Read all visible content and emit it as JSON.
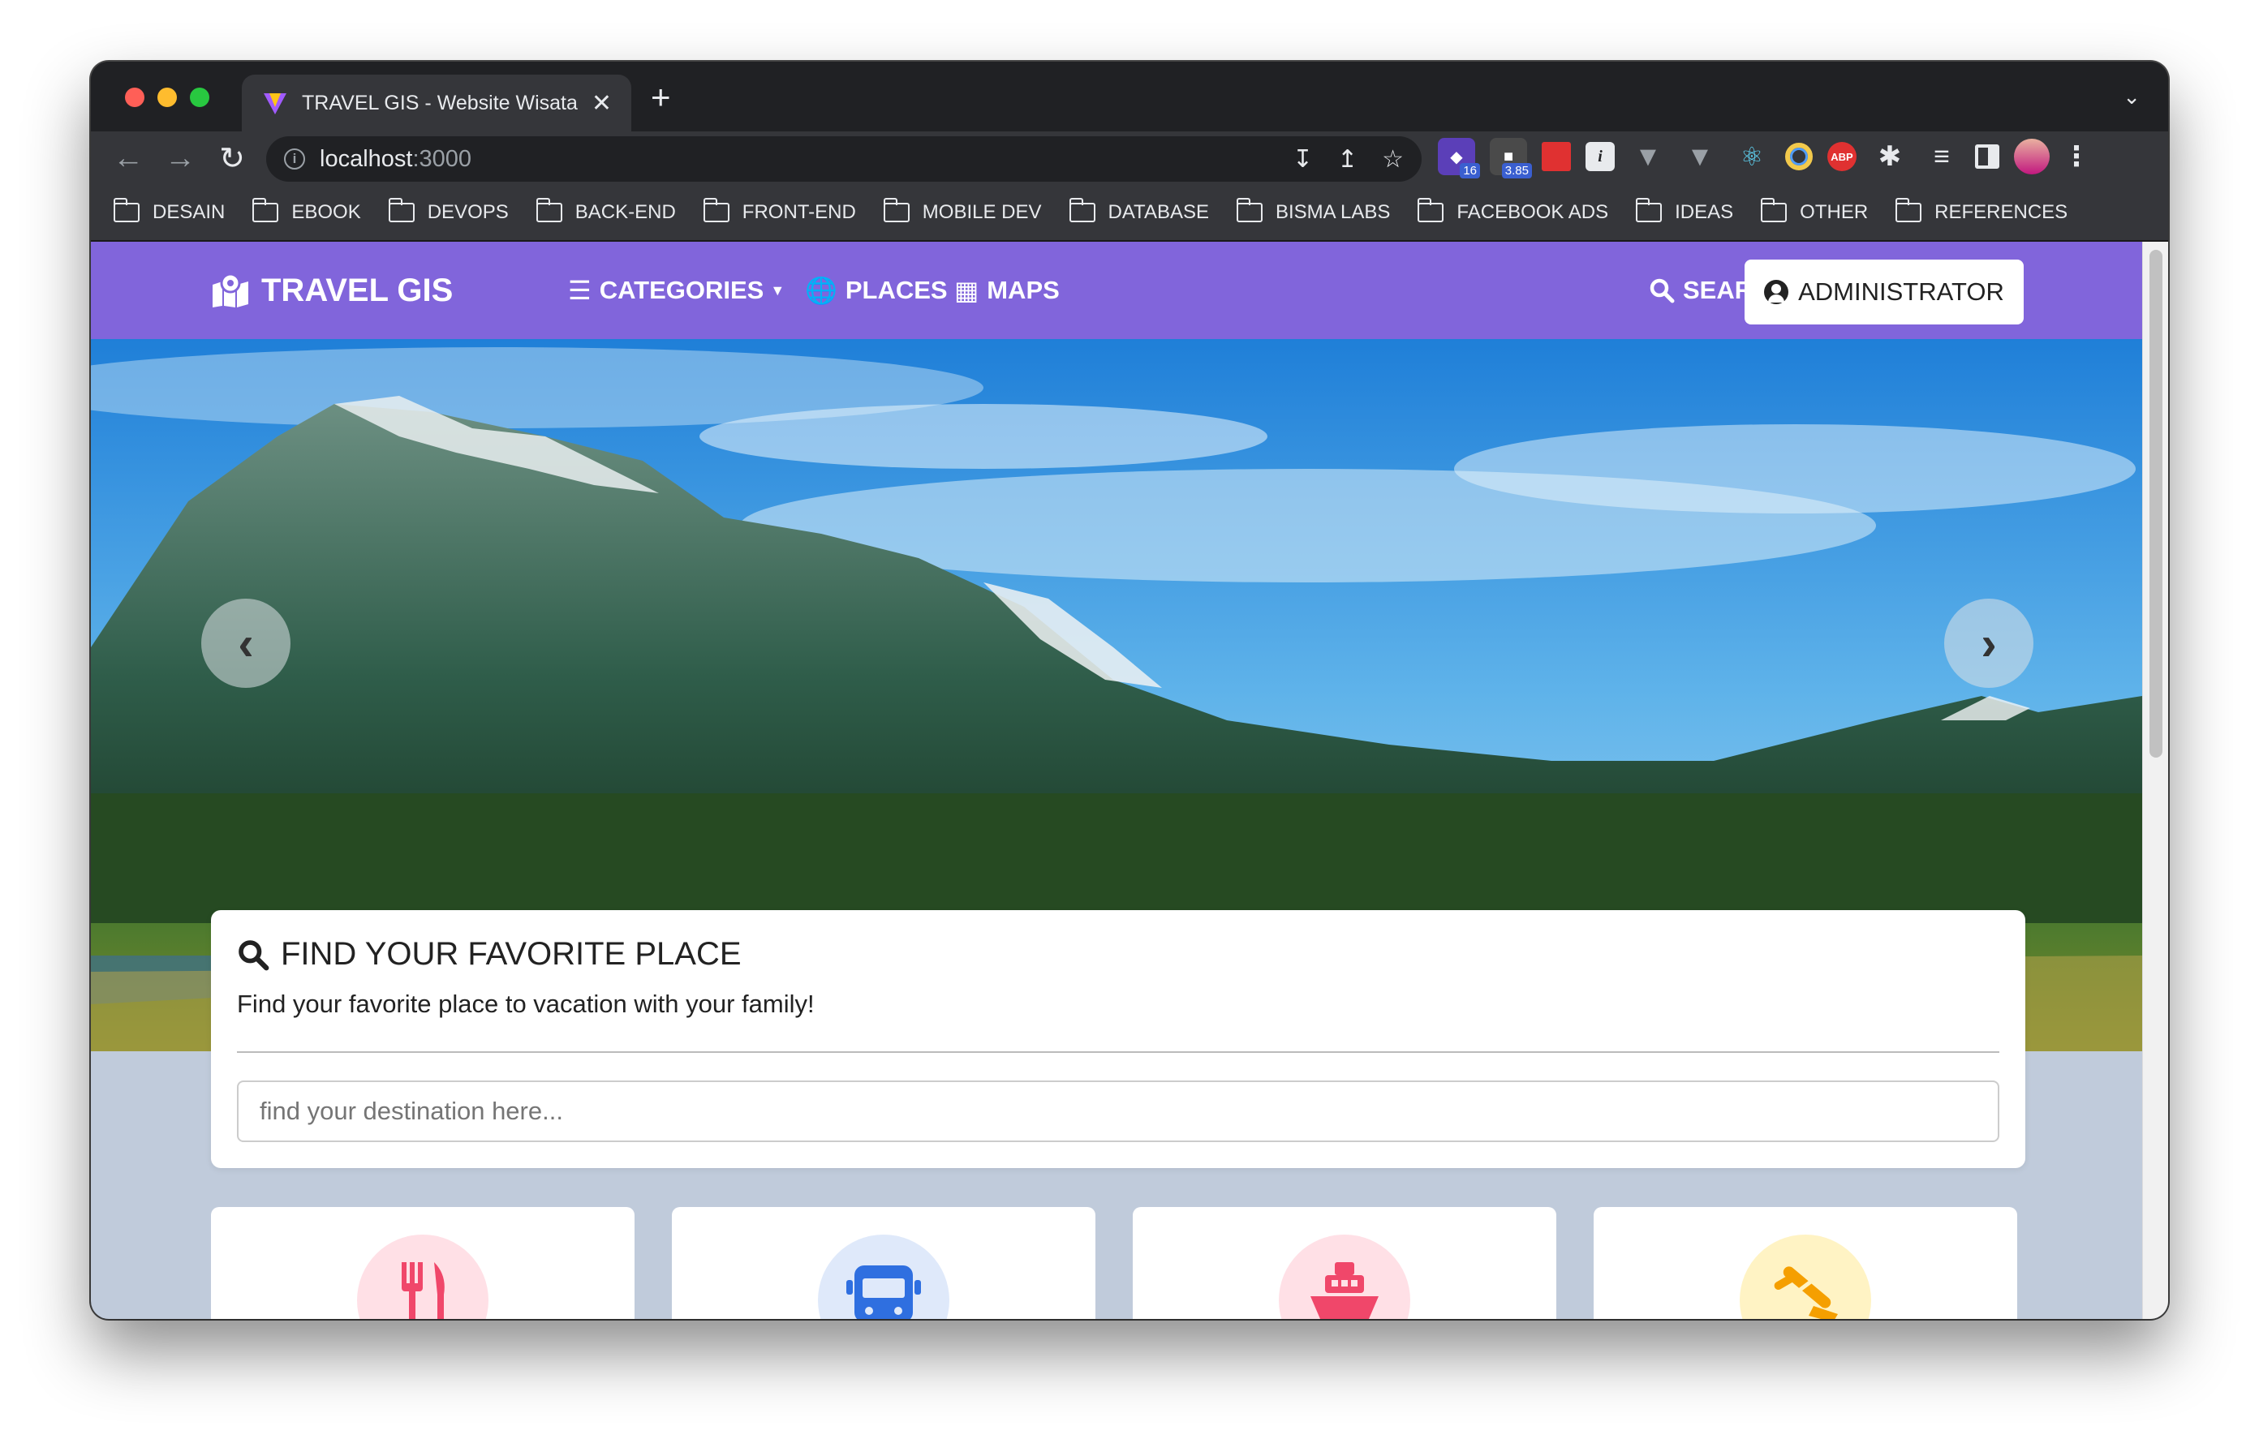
{
  "browser": {
    "tab_title": "TRAVEL GIS - Website Wisata I",
    "tab_close": "✕",
    "new_tab": "+",
    "url_host": "localhost",
    "url_port": ":3000",
    "extensions": [
      {
        "name": "ext-1",
        "badge": "16",
        "color": "#5b3fb8"
      },
      {
        "name": "ext-2",
        "badge": "3.85",
        "color": "#4a4a4a"
      },
      {
        "name": "ext-3",
        "badge": "",
        "color": "#e03131"
      },
      {
        "name": "ext-4",
        "badge": "",
        "color": "#e8eaed"
      },
      {
        "name": "ext-abp",
        "badge": "",
        "color": "#e03131",
        "label": "ABP"
      }
    ],
    "bookmarks": [
      "DESAIN",
      "EBOOK",
      "DEVOPS",
      "BACK-END",
      "FRONT-END",
      "MOBILE DEV",
      "DATABASE",
      "BISMA LABS",
      "FACEBOOK ADS",
      "IDEAS",
      "OTHER",
      "REFERENCES"
    ]
  },
  "navbar": {
    "brand": "TRAVEL GIS",
    "categories": "CATEGORIES",
    "places": "PLACES",
    "maps": "MAPS",
    "search": "SEARCH",
    "admin": "ADMINISTRATOR",
    "color": "#8165db"
  },
  "search_card": {
    "title": "FIND YOUR FAVORITE PLACE",
    "subtitle": "Find your favorite place to vacation with your family!",
    "placeholder": "find your destination here..."
  },
  "categories": [
    {
      "icon": "utensils-icon",
      "bg": "#ffe0e6",
      "color": "#f0476a"
    },
    {
      "icon": "bus-icon",
      "bg": "#dfe9fa",
      "color": "#2f6fe0"
    },
    {
      "icon": "ship-icon",
      "bg": "#ffe0e6",
      "color": "#f0476a"
    },
    {
      "icon": "beach-icon",
      "bg": "#fff3c4",
      "color": "#f59f00"
    }
  ]
}
